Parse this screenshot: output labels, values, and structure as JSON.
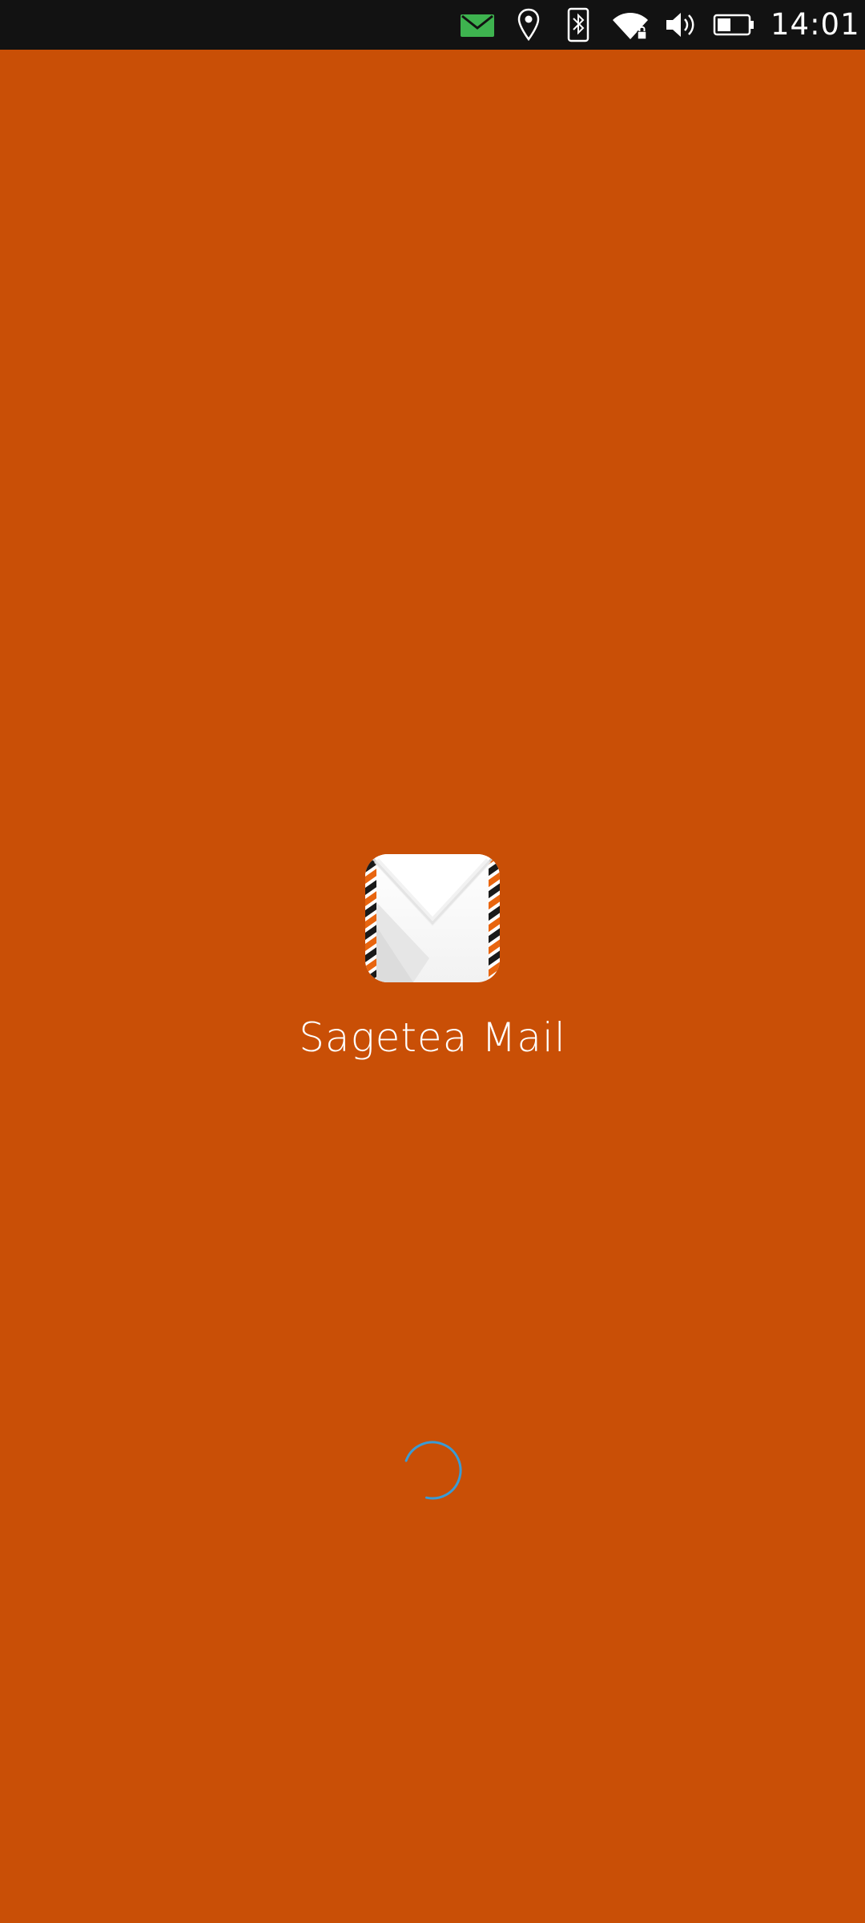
{
  "status_bar": {
    "time": "14:01",
    "icons": [
      "mail-notification-icon",
      "location-icon",
      "bluetooth-icon",
      "wifi-secure-icon",
      "volume-icon",
      "battery-icon"
    ],
    "notification_color": "#3eb34f"
  },
  "splash": {
    "app_name": "Sagetea Mail",
    "background_color": "#c94f06",
    "app_icon": "envelope-airmail-icon",
    "loading_indicator": "activity-spinner",
    "spinner_color": "#3a9bd5"
  }
}
